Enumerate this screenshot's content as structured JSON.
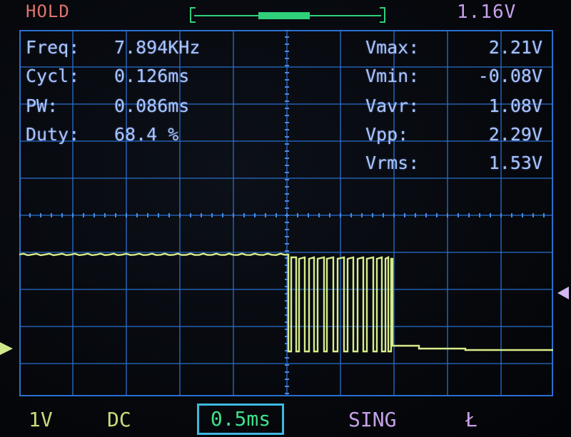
{
  "status": {
    "hold_label": "HOLD",
    "trigger_level": "1.16V"
  },
  "measurements_left": [
    {
      "label": "Freq:",
      "value": "7.894KHz"
    },
    {
      "label": "Cycl:",
      "value": "0.126ms"
    },
    {
      "label": "PW:",
      "value": "0.086ms"
    },
    {
      "label": "Duty:",
      "value": "68.4 %"
    }
  ],
  "measurements_right": [
    {
      "label": "Vmax:",
      "value": "2.21V"
    },
    {
      "label": "Vmin:",
      "value": "-0.08V"
    },
    {
      "label": "Vavr:",
      "value": "1.08V"
    },
    {
      "label": "Vpp:",
      "value": "2.29V"
    },
    {
      "label": "Vrms:",
      "value": "1.53V"
    }
  ],
  "bottom": {
    "volts_per_div": "1V",
    "coupling": "DC",
    "timebase": "0.5ms",
    "trigger_mode": "SING",
    "trigger_edge": "Ł"
  },
  "colors": {
    "trace": "#d8ec8a",
    "grid": "#2a6fd0",
    "grid_dots": "#4a8ae6"
  },
  "buffer_position": 0.36,
  "icons": [
    "trigger-marker-icon",
    "ground-marker-icon",
    "buffer-bar-icon"
  ]
}
